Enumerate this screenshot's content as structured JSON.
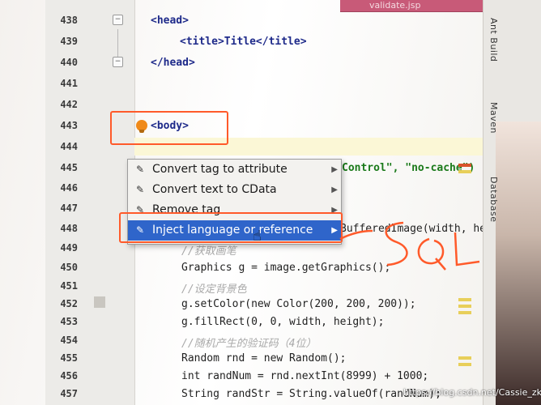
{
  "editor": {
    "tab_title": "validate.jsp",
    "line_numbers": [
      "438",
      "439",
      "440",
      "441",
      "442",
      "443",
      "444",
      "445",
      "446",
      "447",
      "448",
      "449",
      "450",
      "451",
      "452",
      "453",
      "454",
      "455",
      "456",
      "457"
    ],
    "code_lines": {
      "l438": "<head>",
      "l439": "<title>Title</title>",
      "l440": "</head>",
      "l443": "<body>",
      "l445": "Control\", \"no-cache\")",
      "l448": "BufferedImage(width, hei",
      "l449": "//获取画笔",
      "l450": "Graphics g = image.getGraphics();",
      "l451": "//设定背景色",
      "l452": "g.setColor(new Color(200, 200, 200));",
      "l453": "g.fillRect(0, 0, width, height);",
      "l454": "//随机产生的验证码（4位）",
      "l455": "Random rnd = new Random();",
      "l456": "int randNum = rnd.nextInt(8999) + 1000;",
      "l457": "String randStr = String.valueOf(randNum);"
    }
  },
  "context_menu": {
    "items": [
      {
        "label": "Convert tag to attribute",
        "icon": "intention-icon"
      },
      {
        "label": "Convert text to CData",
        "icon": "intention-icon"
      },
      {
        "label": "Remove tag",
        "icon": "intention-icon"
      },
      {
        "label": "Inject language or reference",
        "icon": "intention-icon",
        "selected": true
      }
    ]
  },
  "tool_windows": {
    "ant_build": "Ant Build",
    "maven": "Maven",
    "database": "Database"
  },
  "annotation": {
    "text": "SQL",
    "color": "#ff5a2a"
  },
  "watermark": "https://blog.csdn.net/Cassie_zkg"
}
